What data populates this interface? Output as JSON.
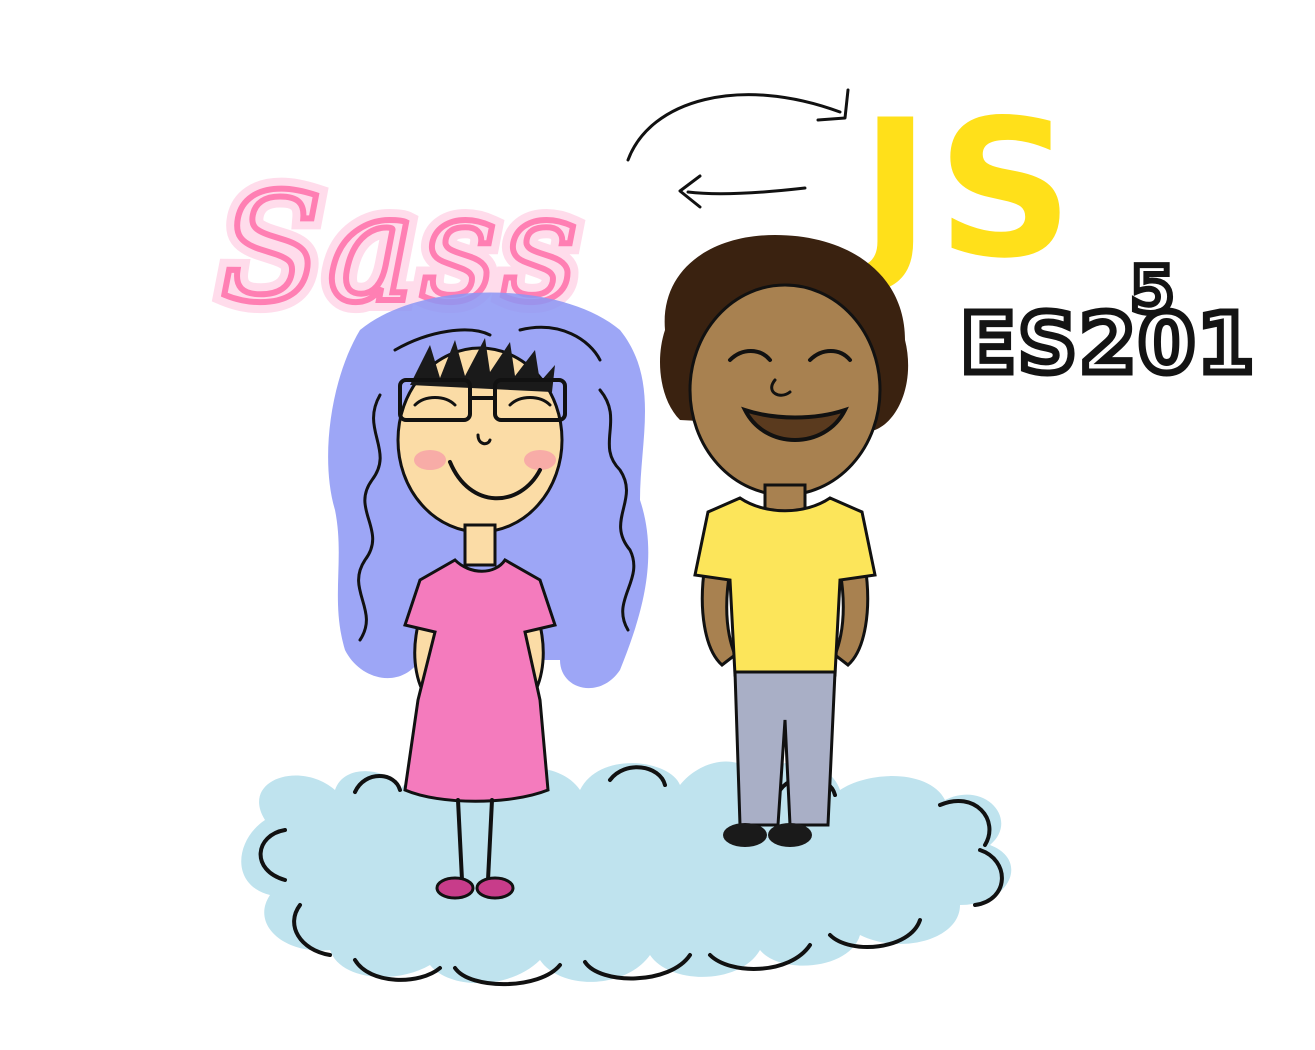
{
  "illustration": {
    "sass_label": "Sass",
    "js_label": "JS",
    "es_label": "ES201",
    "es_superscript": "5"
  },
  "colors": {
    "sass_pink": "#ff7fb3",
    "js_yellow": "#ffe01a",
    "cloud_blue": "#bfe3ee",
    "hair_blue": "#7f8cf2",
    "dress_pink": "#f47bbd",
    "shirt_yellow": "#fce55a",
    "skin_light": "#fbdca6",
    "skin_dark": "#a88150",
    "hair_dark": "#3a2210",
    "jeans_gray": "#a9afc6"
  },
  "icons": [
    "curved-arrow-right-icon",
    "arrow-left-icon"
  ]
}
